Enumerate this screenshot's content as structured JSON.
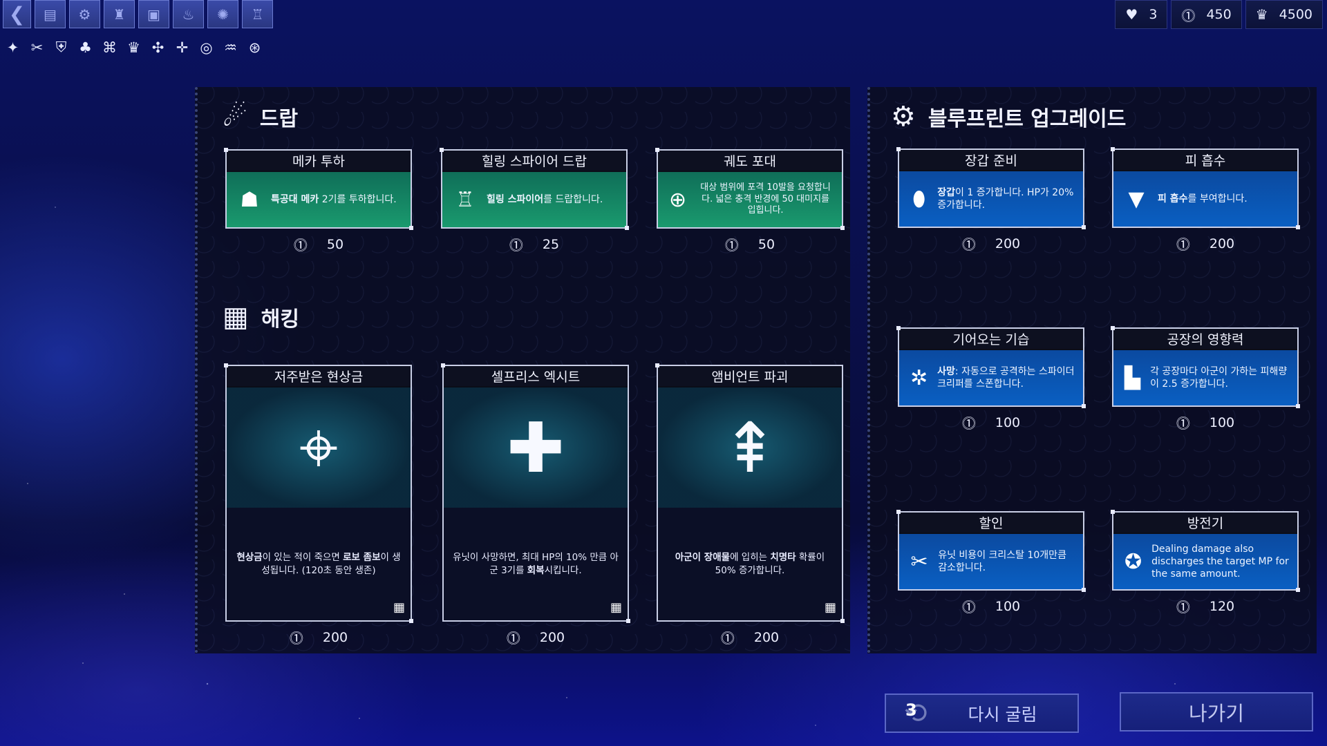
{
  "toolbar": {
    "buttons": [
      {
        "name": "back-button",
        "glyph": "❮"
      },
      {
        "name": "card-icon",
        "glyph": "▤"
      },
      {
        "name": "mech-icon",
        "glyph": "⚙"
      },
      {
        "name": "tower-icon",
        "glyph": "♜"
      },
      {
        "name": "factory-icon",
        "glyph": "▣"
      },
      {
        "name": "flame-icon",
        "glyph": "♨"
      },
      {
        "name": "virus-icon",
        "glyph": "✺"
      },
      {
        "name": "castle-icon",
        "glyph": "♖"
      }
    ],
    "icons": [
      "✦",
      "✂",
      "⛨",
      "♣",
      "⌘",
      "♛",
      "✣",
      "✛",
      "◎",
      "♒",
      "⊛"
    ]
  },
  "resources": {
    "lives": "3",
    "credits": "450",
    "score": "4500",
    "lives_icon": "♥",
    "credits_icon": "⓵",
    "score_icon": "♛"
  },
  "drop": {
    "title": "드랍",
    "icon": "☄",
    "cards": [
      {
        "title": "메카 투하",
        "icon": "☗",
        "desc_bold": "특공대 메카",
        "desc": " 2기를 투하합니다.",
        "price": "50"
      },
      {
        "title": "힐링 스파이어 드랍",
        "icon": "♖",
        "desc_bold": "힐링 스파이어",
        "desc": "를 드랍합니다.",
        "price": "25"
      },
      {
        "title": "궤도 포대",
        "icon": "⊕",
        "desc_bold": "",
        "desc": "대상 범위에 포격 10발을 요청합니다. 넓은 충격 반경에 50 대미지를 입힙니다.",
        "price": "50"
      }
    ]
  },
  "hacking": {
    "title": "해킹",
    "icon": "▦",
    "cards": [
      {
        "title": "저주받은 현상금",
        "art": "⌖",
        "desc_html_bold1": "현상금",
        "desc1": "이 있는 적이 죽으면 ",
        "desc_html_bold2": "로보 좀보",
        "desc2": "이 생성됩니다. (120초 동안 생존)",
        "price": "200"
      },
      {
        "title": "셀프리스 엑시트",
        "art": "✚",
        "desc_html_bold1": "",
        "desc1": "유닛이 사망하면, 최대 HP의 10% 만큼 아군 3기를 ",
        "desc_html_bold2": "회복",
        "desc2": "시킵니다.",
        "price": "200"
      },
      {
        "title": "앰비언트 파괴",
        "art": "⇞",
        "desc_html_bold1": "아군이 장애물",
        "desc1": "에 입히는 ",
        "desc_html_bold2": "치명타",
        "desc2": " 확률이 50% 증가합니다.",
        "price": "200"
      }
    ]
  },
  "blueprint": {
    "title": "블루프린트 업그레이드",
    "icon": "⚙",
    "cards": [
      {
        "title": "장갑 준비",
        "icon": "⬮",
        "bold": "장갑",
        "text": "이 1 증가합니다. HP가 20% 증가합니다.",
        "price": "200"
      },
      {
        "title": "피 흡수",
        "icon": "▼",
        "bold": "피 흡수",
        "text": "를 부여합니다.",
        "price": "200"
      },
      {
        "title": "기어오는 기습",
        "icon": "✲",
        "bold": "사망",
        "text": ": 자동으로 공격하는 스파이더 크리퍼를 스폰합니다.",
        "price": "100"
      },
      {
        "title": "공장의 영향력",
        "icon": "▙",
        "bold": "",
        "text": "각 공장마다 아군이 가하는 피해량이 2.5 증가합니다.",
        "price": "100"
      },
      {
        "title": "할인",
        "icon": "✂",
        "bold": "",
        "text": "유닛 비용이 크리스탈 10개만큼 감소합니다.",
        "price": "100"
      },
      {
        "title": "방전기",
        "icon": "✪",
        "bold": "",
        "text": "Dealing damage also discharges the target MP for the same amount.",
        "price": "120"
      }
    ]
  },
  "buttons": {
    "reroll_label": "다시 굴림",
    "reroll_count": "3",
    "exit_label": "나가기"
  },
  "colors": {
    "drop_card": "#148a63",
    "upgrade_card": "#0a5fc2",
    "panel_bg": "#0a0d20"
  }
}
